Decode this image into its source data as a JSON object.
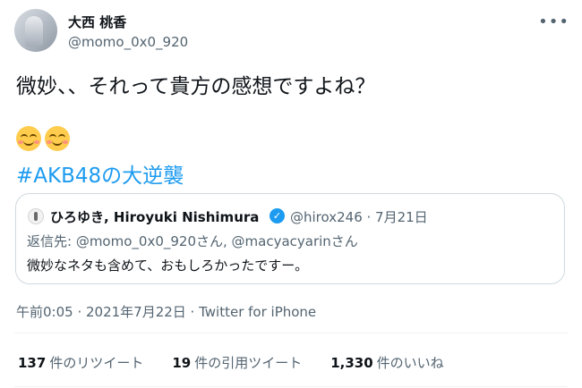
{
  "author": {
    "display_name": "大西 桃香",
    "handle": "@momo_0x0_920"
  },
  "tweet": {
    "text": "微妙、、それって貴方の感想ですよね？",
    "emoji": [
      "smiling-face-with-blush",
      "smiling-face-with-blush"
    ],
    "hashtag": "#AKB48の大逆襲"
  },
  "quoted_tweet": {
    "author_name": "ひろゆき, Hiroyuki Nishimura",
    "meta": "@hirox246 · 7月21日",
    "reply_to": "返信先: @momo_0x0_920さん, @macyacyarinさん",
    "text": "微妙なネタも含めて、おもしろかったですー。"
  },
  "timestamp": "午前0:05 · 2021年7月22日 · Twitter for iPhone",
  "stats": {
    "retweets_count": "137",
    "retweets_label": "件のリツイート",
    "quotes_count": "19",
    "quotes_label": "件の引用ツイート",
    "likes_count": "1,330",
    "likes_label": "件のいいね"
  },
  "colors": {
    "accent": "#1d9bf0",
    "secondary_text": "#536471",
    "primary_text": "#0f1419"
  },
  "icons": {
    "more": "more-icon",
    "verified": "verified-badge-icon"
  }
}
